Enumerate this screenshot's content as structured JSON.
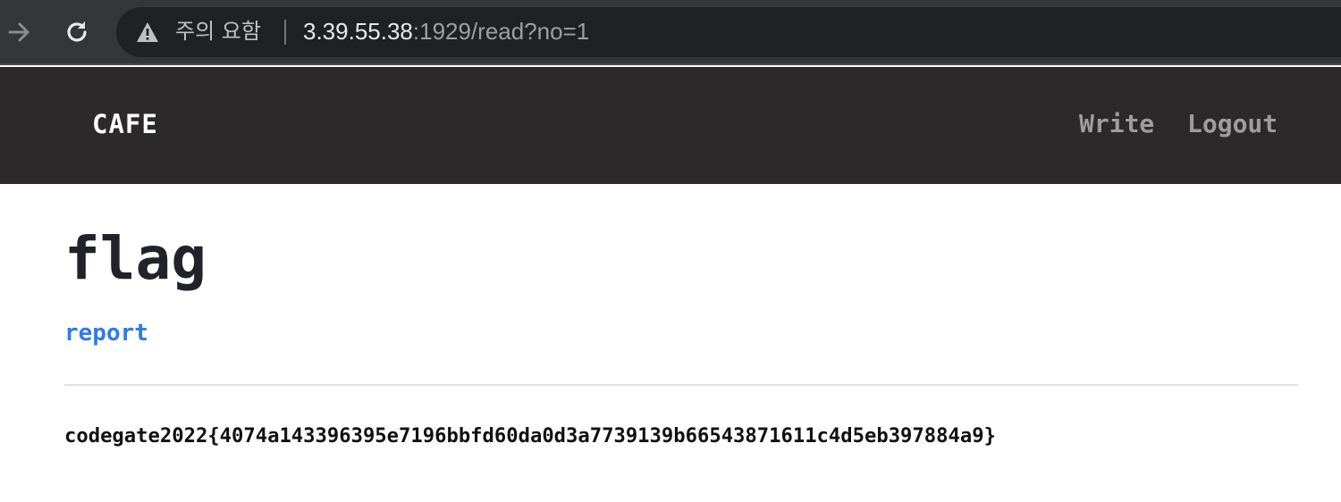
{
  "browser": {
    "security_label": "주의 요함",
    "url_host": "3.39.55.38",
    "url_rest": ":1929/read?no=1"
  },
  "nav": {
    "brand": "CAFE",
    "links": [
      "Write",
      "Logout"
    ]
  },
  "post": {
    "title": "flag",
    "report_label": "report",
    "body": "codegate2022{4074a143396395e7196bbfd60da0d3a7739139b66543871611c4d5eb397884a9}"
  }
}
